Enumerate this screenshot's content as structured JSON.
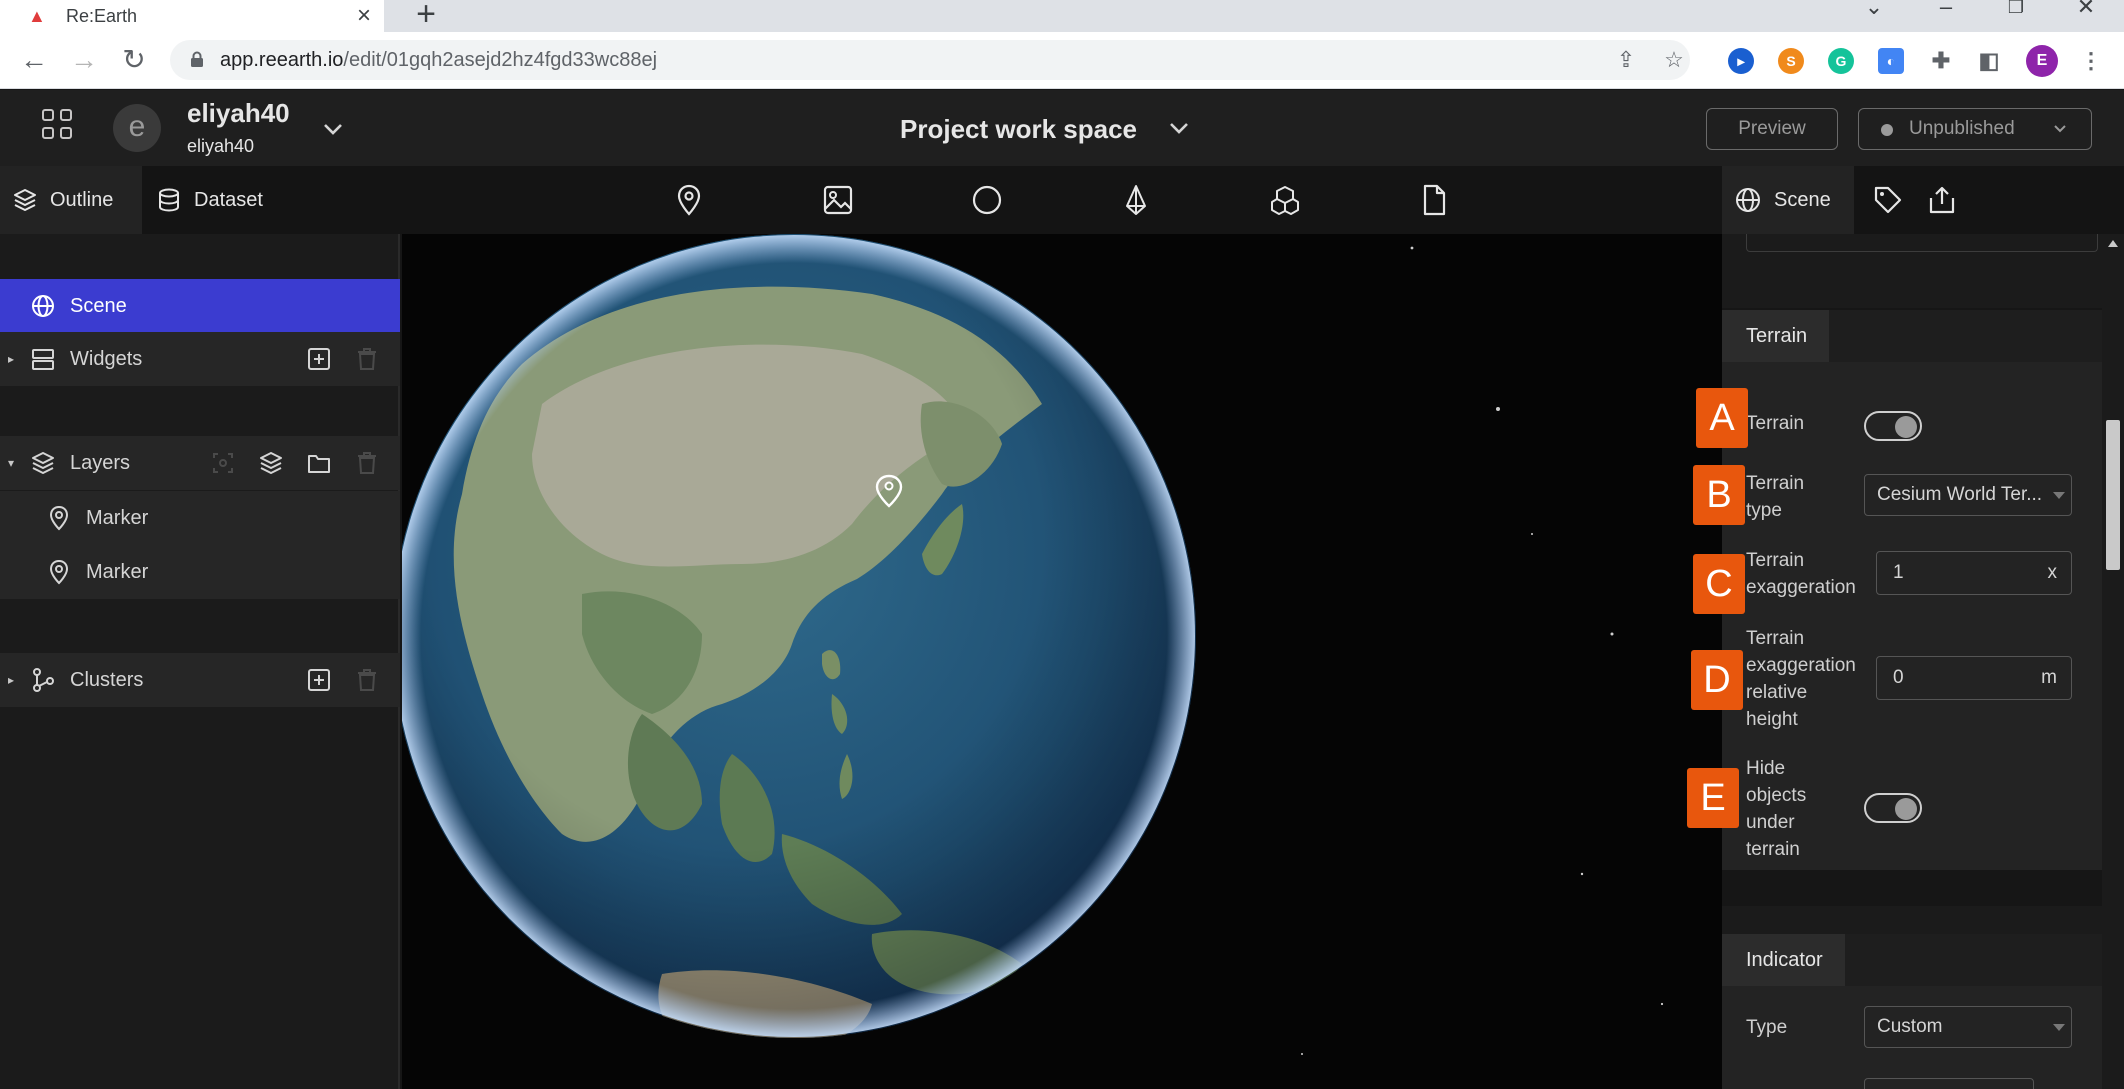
{
  "browser": {
    "tab_title": "Re:Earth",
    "url_host": "app.reearth.io",
    "url_path": "/edit/01gqh2asejd2hz4fgd33wc88ej",
    "profile_initial": "E"
  },
  "header": {
    "avatar_letter": "e",
    "workspace_name": "eliyah40",
    "workspace_sub": "eliyah40",
    "project_title": "Project work space",
    "preview_label": "Preview",
    "publish_label": "Unpublished"
  },
  "left_tabs": [
    {
      "label": "Outline"
    },
    {
      "label": "Dataset"
    }
  ],
  "right_tabs": {
    "active_label": "Scene"
  },
  "outline": {
    "scene": "Scene",
    "widgets": "Widgets",
    "layers": "Layers",
    "markers": [
      "Marker",
      "Marker"
    ],
    "clusters": "Clusters"
  },
  "terrain": {
    "section_title": "Terrain",
    "terrain_label": "Terrain",
    "terrain_type_label_1": "Terrain",
    "terrain_type_label_2": "type",
    "terrain_type_value": "Cesium World Ter...",
    "exag_label_1": "Terrain",
    "exag_label_2": "exaggeration",
    "exag_value": "1",
    "exag_unit": "x",
    "rel_label_1": "Terrain",
    "rel_label_2": "exaggeration",
    "rel_label_3": "relative",
    "rel_label_4": "height",
    "rel_value": "0",
    "rel_unit": "m",
    "hide_label_1": "Hide",
    "hide_label_2": "objects",
    "hide_label_3": "under",
    "hide_label_4": "terrain",
    "terrain_on": true,
    "hide_on": true
  },
  "indicator": {
    "section_title": "Indicator",
    "type_label": "Type",
    "type_value": "Custom"
  },
  "annotations": [
    "A",
    "B",
    "C",
    "D",
    "E"
  ],
  "colors": {
    "accent": "#3b3cd0",
    "annotation": "#e8570d"
  }
}
